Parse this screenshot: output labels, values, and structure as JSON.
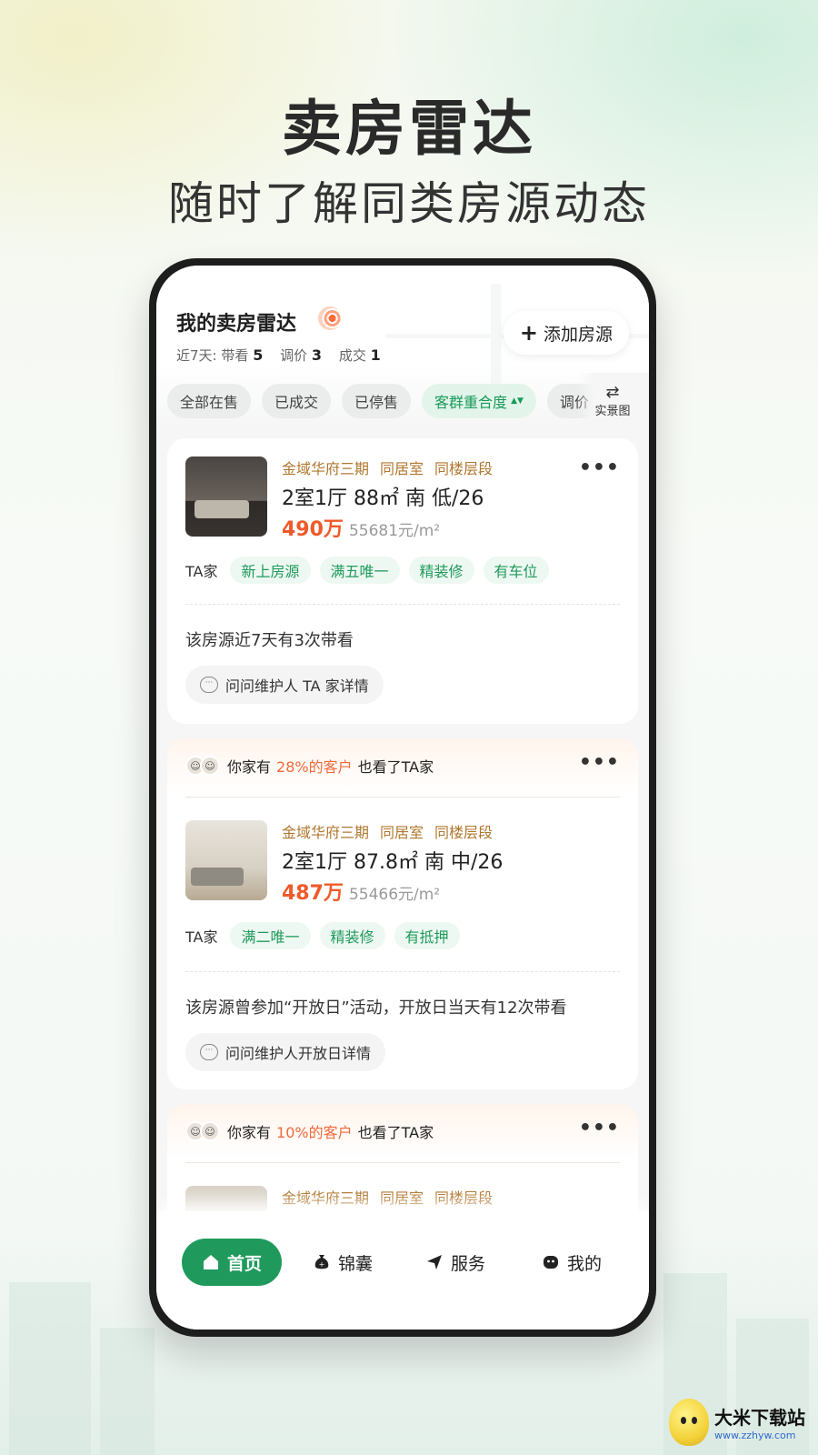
{
  "hero": {
    "title": "卖房雷达",
    "subtitle": "随时了解同类房源动态"
  },
  "header": {
    "title": "我的卖房雷达",
    "stats_label": "近7天:",
    "stats": [
      {
        "label": "带看",
        "value": "5"
      },
      {
        "label": "调价",
        "value": "3"
      },
      {
        "label": "成交",
        "value": "1"
      }
    ],
    "add_button": "添加房源"
  },
  "filters": {
    "chips": [
      "全部在售",
      "已成交",
      "已停售",
      "客群重合度",
      "调价"
    ],
    "active_index": 3,
    "view_toggle": "实景图"
  },
  "listings": [
    {
      "tags": [
        "金域华府三期",
        "同居室",
        "同楼层段"
      ],
      "spec": "2室1厅 88㎡ 南 低/26",
      "price": "490万",
      "unit_price": "55681元/m²",
      "owner_label": "TA家",
      "features": [
        "新上房源",
        "满五唯一",
        "精装修",
        "有车位"
      ],
      "note": "该房源近7天有3次带看",
      "ask": "问问维护人 TA 家详情"
    },
    {
      "header_prefix": "你家有",
      "header_highlight": "28%的客户",
      "header_suffix": "也看了TA家",
      "tags": [
        "金域华府三期",
        "同居室",
        "同楼层段"
      ],
      "spec": "2室1厅 87.8㎡ 南 中/26",
      "price": "487万",
      "unit_price": "55466元/m²",
      "owner_label": "TA家",
      "features": [
        "满二唯一",
        "精装修",
        "有抵押"
      ],
      "note": "该房源曾参加“开放日”活动，开放日当天有12次带看",
      "ask": "问问维护人开放日详情"
    },
    {
      "header_prefix": "你家有",
      "header_highlight": "10%的客户",
      "header_suffix": "也看了TA家",
      "tags": [
        "金域华府三期",
        "同居室",
        "同楼层段"
      ]
    }
  ],
  "bottom_nav": {
    "items": [
      "首页",
      "锦囊",
      "服务",
      "我的"
    ],
    "active_index": 0
  },
  "watermark": {
    "name": "大米下载站",
    "url": "www.zzhyw.com"
  },
  "colors": {
    "accent_green": "#1f9a5c",
    "price_red": "#ef5a2a",
    "tag_gold": "#b0772f",
    "highlight_orange": "#ef6a3a"
  }
}
